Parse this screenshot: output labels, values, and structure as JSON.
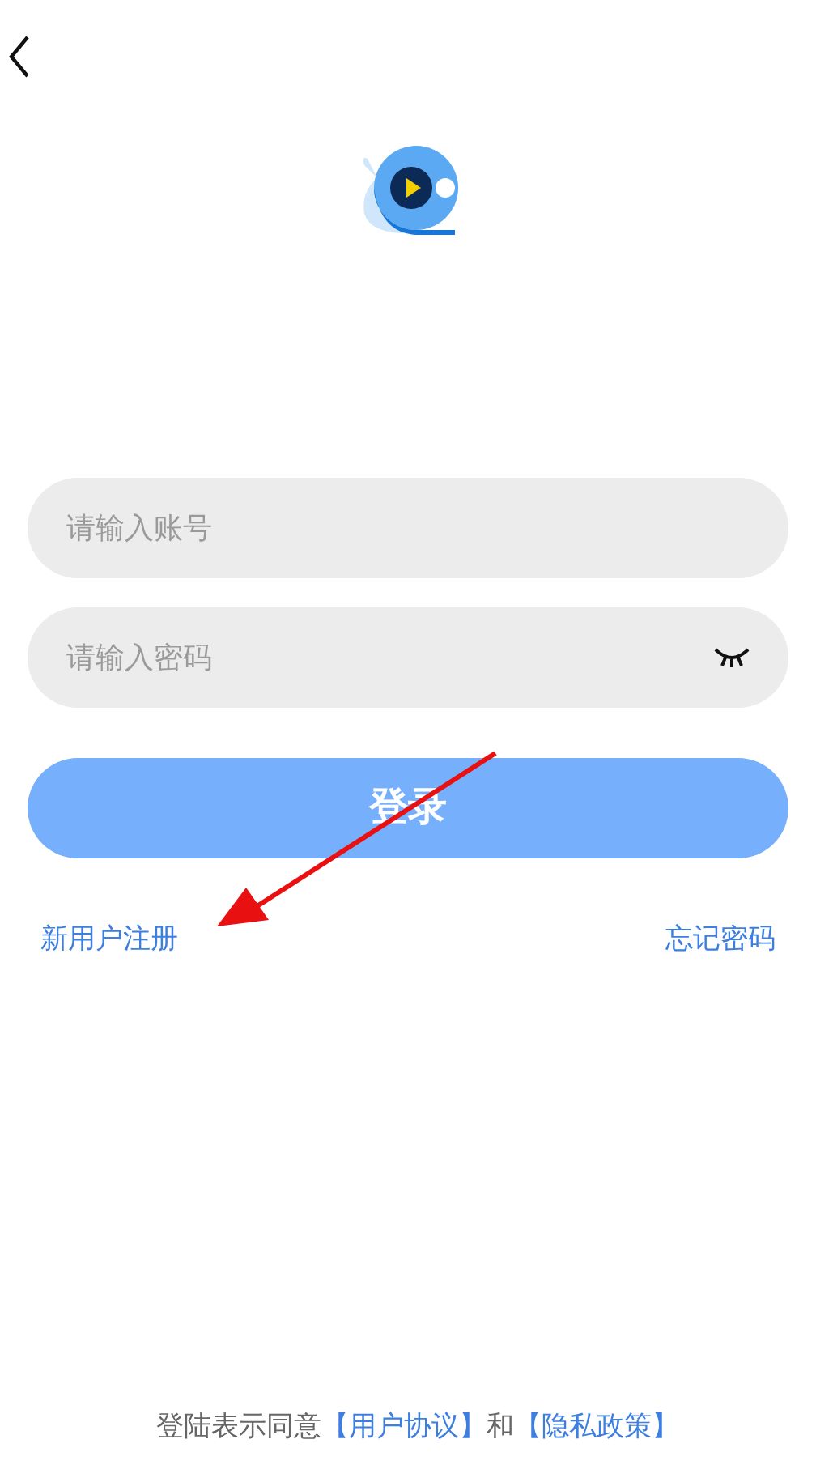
{
  "fields": [
    {
      "kind": "text",
      "placeholder": "请输入账号"
    },
    {
      "kind": "password",
      "placeholder": "请输入密码"
    }
  ],
  "login_button": "登录",
  "links": {
    "register": "新用户注册",
    "forgot": "忘记密码"
  },
  "footer": [
    {
      "kind": "text",
      "text": "登陆表示同意"
    },
    {
      "kind": "link",
      "text": "【用户协议】"
    },
    {
      "kind": "text",
      "text": "和"
    },
    {
      "kind": "link",
      "text": "【隐私政策】"
    }
  ]
}
